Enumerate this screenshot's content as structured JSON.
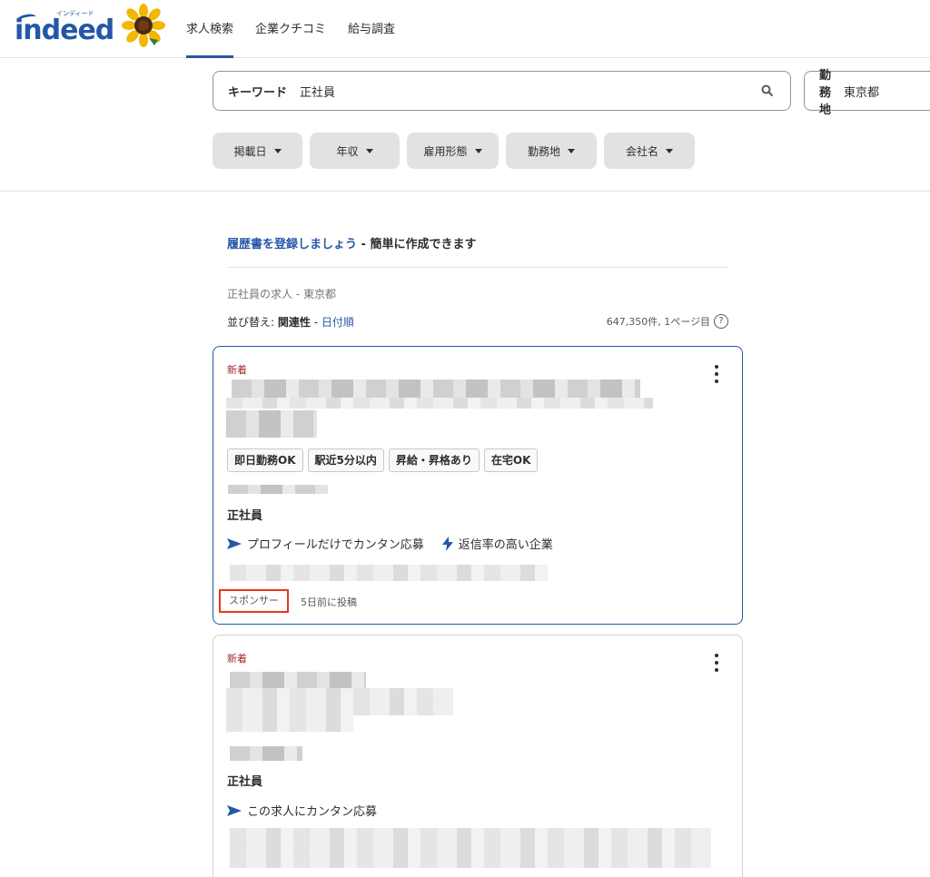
{
  "header": {
    "logo_text": "indeed",
    "logo_ruby": "インディード",
    "nav": [
      "求人検索",
      "企業クチコミ",
      "給与調査"
    ]
  },
  "search": {
    "keyword_label": "キーワード",
    "keyword_value": "正社員",
    "location_label": "勤務地",
    "location_value": "東京都"
  },
  "filters": [
    "掲載日",
    "年収",
    "雇用形態",
    "勤務地",
    "会社名"
  ],
  "resume_banner": {
    "link": "履歴書を登録しましょう",
    "rest": " - 簡単に作成できます"
  },
  "results": {
    "query_title": "正社員の求人 - 東京都",
    "sort_prefix": "並び替え: ",
    "sort_active": "関連性",
    "sort_sep": " - ",
    "sort_link": "日付順",
    "count": "647,350件, 1ページ目",
    "help": "?"
  },
  "jobs": [
    {
      "new_label": "新着",
      "tags": [
        "即日勤務OK",
        "駅近5分以内",
        "昇給・昇格あり",
        "在宅OK"
      ],
      "job_type": "正社員",
      "apply": "プロフィールだけでカンタン応募",
      "response": "返信率の高い企業",
      "sponsor": "スポンサー",
      "posted": "5日前に投稿"
    },
    {
      "new_label": "新着",
      "job_type": "正社員",
      "apply": "この求人にカンタン応募"
    }
  ],
  "colors": {
    "brand": "#2557a7",
    "new": "#a9252b",
    "highlight": "#e53a17"
  }
}
